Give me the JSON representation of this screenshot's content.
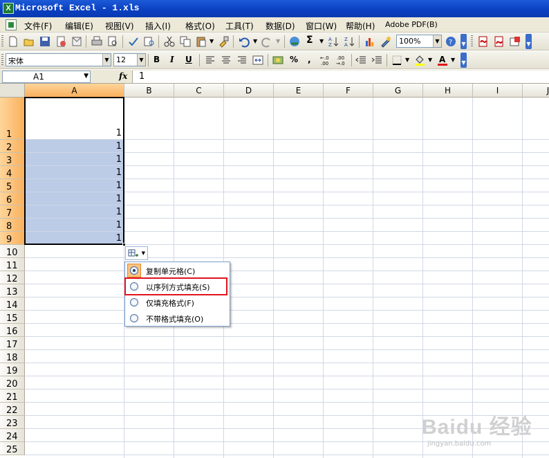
{
  "window": {
    "title": "Microsoft Excel - 1.xls",
    "app_icon": "excel-icon"
  },
  "menu": [
    {
      "label": "文件(F)"
    },
    {
      "label": "编辑(E)"
    },
    {
      "label": "视图(V)"
    },
    {
      "label": "插入(I)"
    },
    {
      "label": "格式(O)"
    },
    {
      "label": "工具(T)"
    },
    {
      "label": "数据(D)"
    },
    {
      "label": "窗口(W)"
    },
    {
      "label": "帮助(H)"
    },
    {
      "label": "Adobe PDF(B)"
    }
  ],
  "toolbar": {
    "zoom": "100%",
    "font_name": "宋体",
    "font_size": "12",
    "bold_label": "B",
    "italic_label": "I",
    "underline_label": "U",
    "percent_label": "%",
    "comma_label": ",",
    "sigma_label": "Σ",
    "font_color": "#e0141c",
    "fill_color": "#ffff00"
  },
  "formula_bar": {
    "name_box": "A1",
    "fx_label": "fx",
    "content": "1"
  },
  "grid": {
    "columns": [
      "A",
      "B",
      "C",
      "D",
      "E",
      "F",
      "G",
      "H",
      "I",
      "J"
    ],
    "rows": [
      "1",
      "2",
      "3",
      "4",
      "5",
      "6",
      "7",
      "8",
      "9",
      "10",
      "11",
      "12",
      "13",
      "14",
      "15",
      "16",
      "17",
      "18",
      "19",
      "20",
      "21",
      "22",
      "23",
      "24",
      "25"
    ],
    "selected_column": "A",
    "selected_range": "A1:A9",
    "cells": [
      "1",
      "1",
      "1",
      "1",
      "1",
      "1",
      "1",
      "1",
      "1"
    ],
    "selection_color": "#bccbe6",
    "header_highlight_color": "#f9b05d"
  },
  "autofill_options": {
    "button_icon": "autofill-options-icon",
    "items": [
      {
        "label": "复制单元格(C)",
        "checked": true
      },
      {
        "label": "以序列方式填充(S)",
        "checked": false
      },
      {
        "label": "仅填充格式(F)",
        "checked": false
      },
      {
        "label": "不带格式填充(O)",
        "checked": false
      }
    ],
    "highlight_color": "#e0141c"
  },
  "watermark": {
    "brand": "Baidu 经验",
    "url": "jingyan.baidu.com"
  }
}
